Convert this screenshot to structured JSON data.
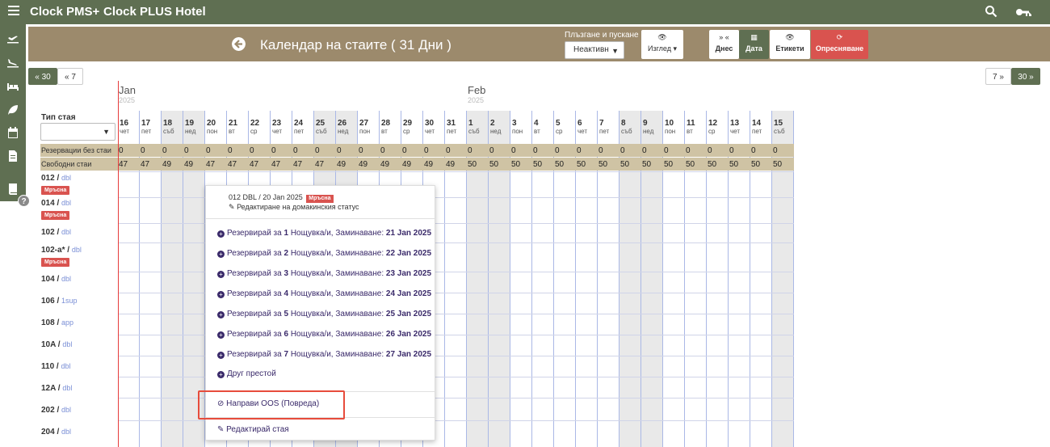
{
  "app": {
    "brand": "Clock PMS+",
    "hotel": "Clock PLUS Hotel"
  },
  "header": {
    "title": "Календар на стаите ( 31 Дни )",
    "drag_label": "Плъзгане и пускане",
    "drag_value": "Неактивн",
    "view_label": "Изглед",
    "today_label": "Днес",
    "date_label": "Дата",
    "labels_label": "Етикети",
    "refresh_label": "Опресняване"
  },
  "nav": {
    "back30": "« 30",
    "back7": "« 7",
    "fwd7": "7 »",
    "fwd30": "30 »"
  },
  "months": [
    {
      "name": "Jan",
      "year": "2025"
    },
    {
      "name": "Feb",
      "year": "2025"
    }
  ],
  "room_type_label": "Тип стая",
  "days": [
    {
      "d": "16",
      "w": "чет"
    },
    {
      "d": "17",
      "w": "пет"
    },
    {
      "d": "18",
      "w": "съб",
      "we": true
    },
    {
      "d": "19",
      "w": "нед",
      "we": true
    },
    {
      "d": "20",
      "w": "пон"
    },
    {
      "d": "21",
      "w": "вт"
    },
    {
      "d": "22",
      "w": "ср"
    },
    {
      "d": "23",
      "w": "чет"
    },
    {
      "d": "24",
      "w": "пет"
    },
    {
      "d": "25",
      "w": "съб",
      "we": true
    },
    {
      "d": "26",
      "w": "нед",
      "we": true
    },
    {
      "d": "27",
      "w": "пон"
    },
    {
      "d": "28",
      "w": "вт"
    },
    {
      "d": "29",
      "w": "ср"
    },
    {
      "d": "30",
      "w": "чет"
    },
    {
      "d": "31",
      "w": "пет"
    },
    {
      "d": "1",
      "w": "съб",
      "we": true
    },
    {
      "d": "2",
      "w": "нед",
      "we": true
    },
    {
      "d": "3",
      "w": "пон"
    },
    {
      "d": "4",
      "w": "вт"
    },
    {
      "d": "5",
      "w": "ср"
    },
    {
      "d": "6",
      "w": "чет"
    },
    {
      "d": "7",
      "w": "пет"
    },
    {
      "d": "8",
      "w": "съб",
      "we": true
    },
    {
      "d": "9",
      "w": "нед",
      "we": true
    },
    {
      "d": "10",
      "w": "пон"
    },
    {
      "d": "11",
      "w": "вт"
    },
    {
      "d": "12",
      "w": "ср"
    },
    {
      "d": "13",
      "w": "чет"
    },
    {
      "d": "14",
      "w": "пет"
    },
    {
      "d": "15",
      "w": "съб",
      "we": true
    }
  ],
  "unassigned": {
    "label": "Резервации без стаи",
    "values": [
      "0",
      "0",
      "0",
      "0",
      "0",
      "0",
      "0",
      "0",
      "0",
      "0",
      "0",
      "0",
      "0",
      "0",
      "0",
      "0",
      "0",
      "0",
      "0",
      "0",
      "0",
      "0",
      "0",
      "0",
      "0",
      "0",
      "0",
      "0",
      "0",
      "0",
      "0"
    ]
  },
  "free": {
    "label": "Свободни стаи",
    "values": [
      "47",
      "47",
      "49",
      "49",
      "47",
      "47",
      "47",
      "47",
      "47",
      "47",
      "49",
      "49",
      "49",
      "49",
      "49",
      "49",
      "50",
      "50",
      "50",
      "50",
      "50",
      "50",
      "50",
      "50",
      "50",
      "50",
      "50",
      "50",
      "50",
      "50",
      "50"
    ]
  },
  "rooms": [
    {
      "num": "012",
      "type": "dbl",
      "dirty": "Мръсна"
    },
    {
      "num": "014",
      "type": "dbl",
      "dirty": "Мръсна"
    },
    {
      "num": "102",
      "type": "dbl"
    },
    {
      "num": "102-a*",
      "type": "dbl",
      "dirty": "Мръсна"
    },
    {
      "num": "104",
      "type": "dbl"
    },
    {
      "num": "106",
      "type": "1sup"
    },
    {
      "num": "108",
      "type": "app"
    },
    {
      "num": "10A",
      "type": "dbl"
    },
    {
      "num": "110",
      "type": "dbl"
    },
    {
      "num": "12A",
      "type": "dbl"
    },
    {
      "num": "202",
      "type": "dbl"
    },
    {
      "num": "204",
      "type": "dbl"
    }
  ],
  "popup": {
    "head": "012 DBL / 20 Jan 2025",
    "head_tag": "Мръсна",
    "hk_edit": "Редактиране на домакинския статус",
    "bookings": [
      {
        "pre": "Резервирай за ",
        "n": "1",
        "mid": " Нощувка/и, Заминаване: ",
        "date": "21 Jan 2025"
      },
      {
        "pre": "Резервирай за ",
        "n": "2",
        "mid": " Нощувка/и, Заминаване: ",
        "date": "22 Jan 2025"
      },
      {
        "pre": "Резервирай за ",
        "n": "3",
        "mid": " Нощувка/и, Заминаване: ",
        "date": "23 Jan 2025"
      },
      {
        "pre": "Резервирай за ",
        "n": "4",
        "mid": " Нощувка/и, Заминаване: ",
        "date": "24 Jan 2025"
      },
      {
        "pre": "Резервирай за ",
        "n": "5",
        "mid": " Нощувка/и, Заминаване: ",
        "date": "25 Jan 2025"
      },
      {
        "pre": "Резервирай за ",
        "n": "6",
        "mid": " Нощувка/и, Заминаване: ",
        "date": "26 Jan 2025"
      },
      {
        "pre": "Резервирай за ",
        "n": "7",
        "mid": " Нощувка/и, Заминаване: ",
        "date": "27 Jan 2025"
      }
    ],
    "other": "Друг престой",
    "oos": "Направи OOS (Повреда)",
    "edit_room": "Редактирай стая"
  },
  "colors": {
    "topbar": "#5f6f52",
    "header": "#9c8a6c",
    "band": "#cfc3a4",
    "danger": "#d9534f",
    "today": "#e63b3b"
  }
}
